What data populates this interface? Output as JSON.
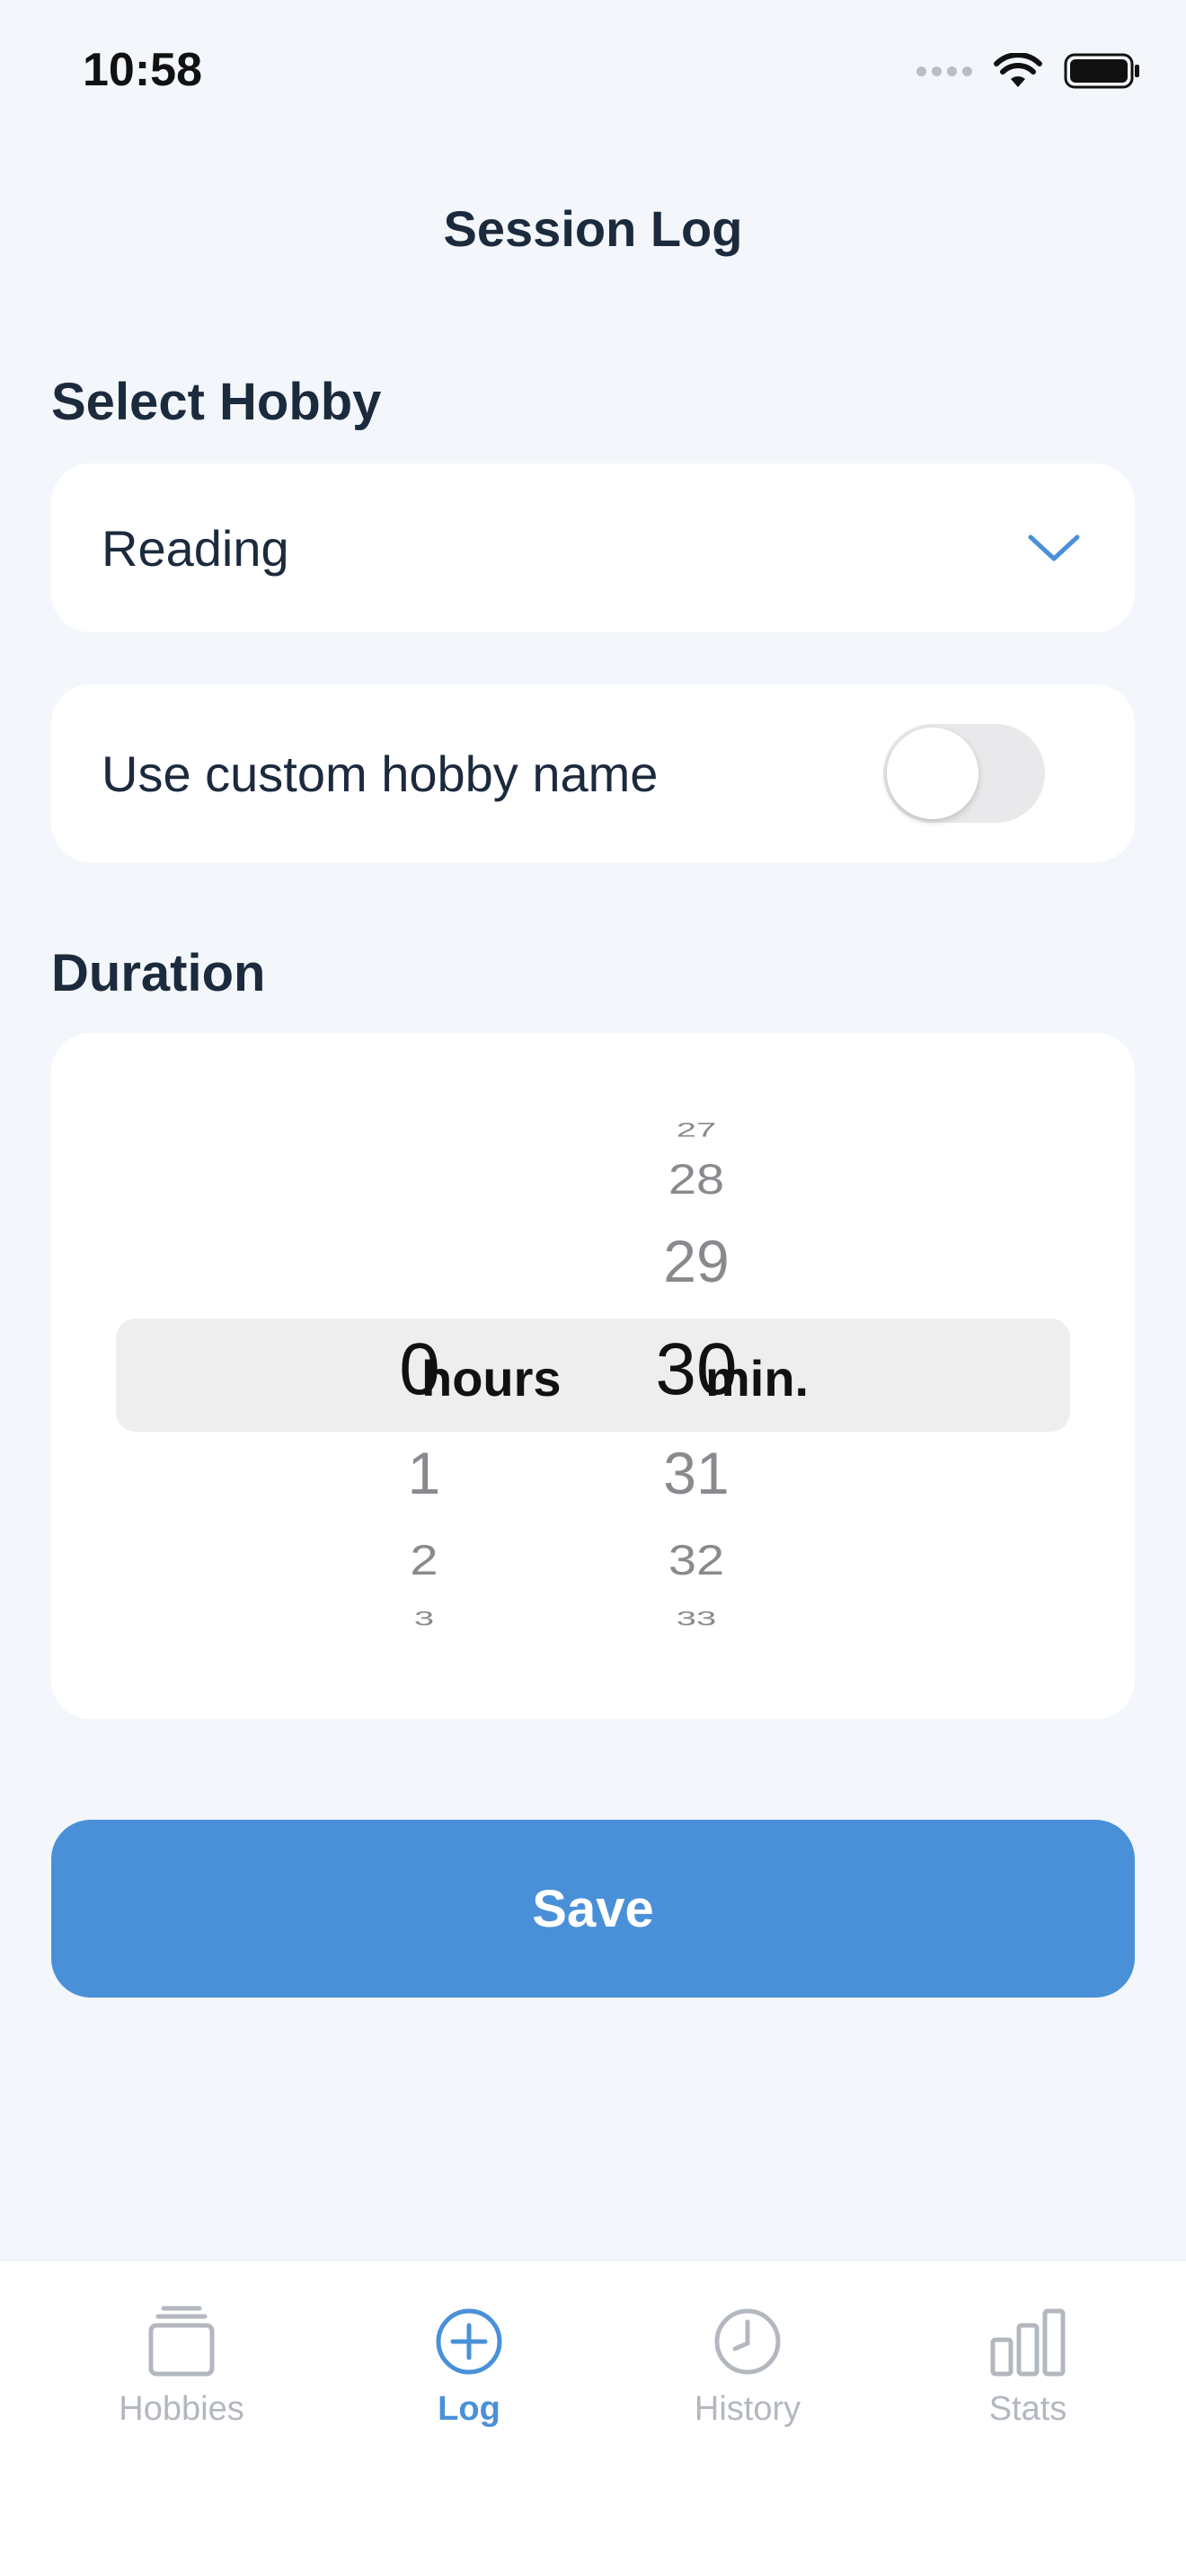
{
  "status_bar": {
    "time": "10:58"
  },
  "header": {
    "title": "Session Log"
  },
  "hobby_section": {
    "label": "Select Hobby",
    "selected_value": "Reading",
    "dropdown_icon": "chevron-down-icon"
  },
  "custom_name": {
    "label": "Use custom hobby name",
    "enabled": false
  },
  "duration_section": {
    "label": "Duration",
    "hours": {
      "selected": "0",
      "unit": "hours",
      "below": [
        "1",
        "2",
        "3"
      ]
    },
    "minutes": {
      "above": [
        "27",
        "28",
        "29"
      ],
      "selected": "30",
      "unit": "min.",
      "below": [
        "31",
        "32",
        "33"
      ]
    }
  },
  "actions": {
    "save_label": "Save"
  },
  "tabbar": {
    "active": "Log",
    "tabs": [
      {
        "label": "Hobbies",
        "icon": "hobbies-stack-icon"
      },
      {
        "label": "Log",
        "icon": "plus-circle-icon"
      },
      {
        "label": "History",
        "icon": "clock-icon"
      },
      {
        "label": "Stats",
        "icon": "bar-chart-icon"
      }
    ]
  },
  "colors": {
    "accent": "#4a90d9",
    "background": "#f3f7fb",
    "text": "#1c2a3d",
    "inactive": "#b3b8bf"
  }
}
